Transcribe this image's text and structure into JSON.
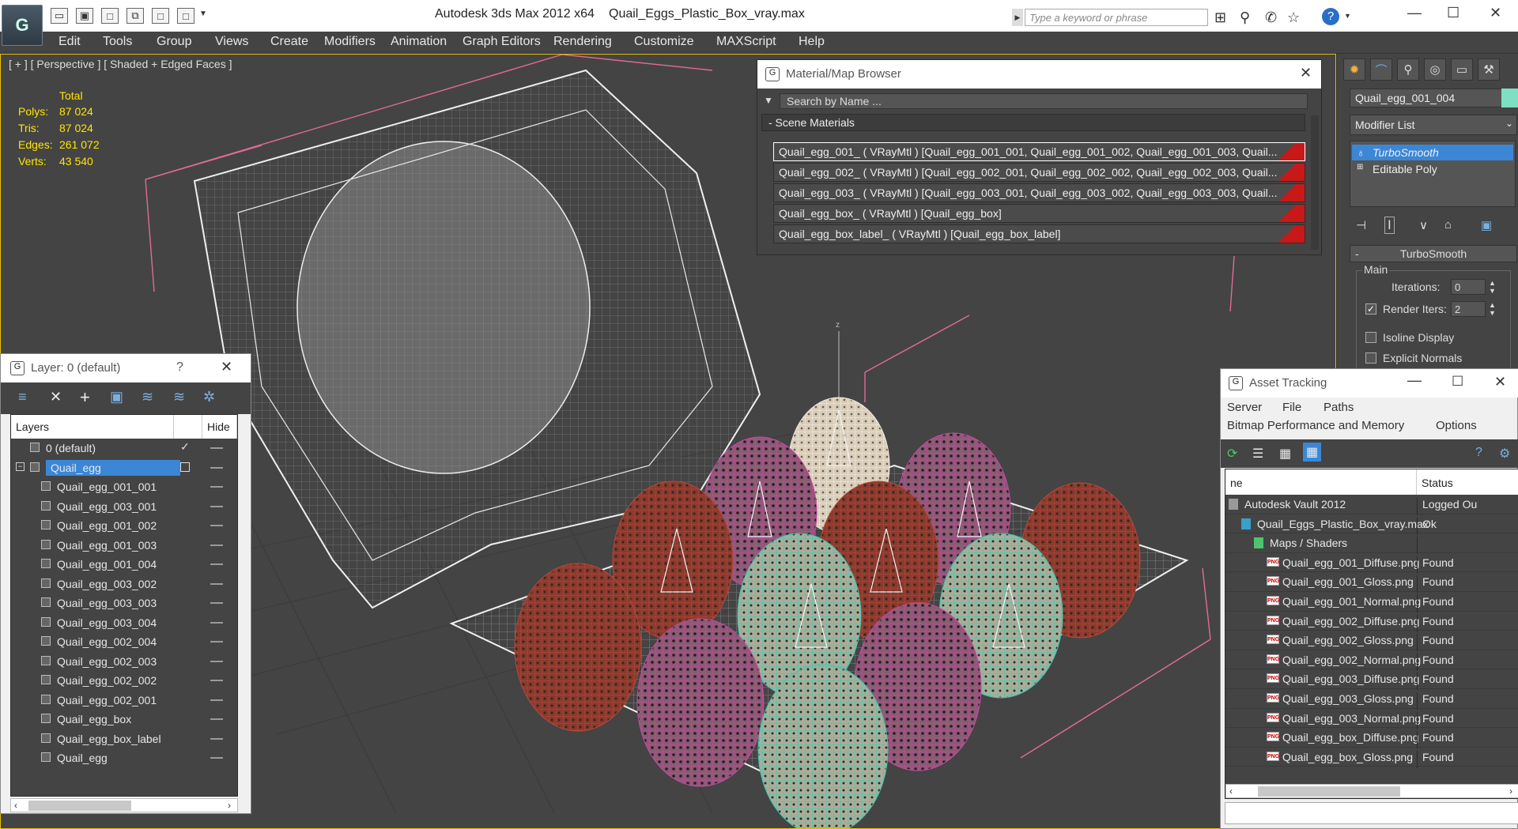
{
  "title_bar": {
    "app_title": "Autodesk 3ds Max  2012 x64",
    "file_title": "Quail_Eggs_Plastic_Box_vray.max",
    "search_placeholder": "Type a keyword or phrase"
  },
  "menu": [
    "Edit",
    "Tools",
    "Group",
    "Views",
    "Create",
    "Modifiers",
    "Animation",
    "Graph Editors",
    "Rendering",
    "Customize",
    "MAXScript",
    "Help"
  ],
  "viewport": {
    "label": "[ + ] [ Perspective ] [ Shaded + Edged Faces ]",
    "stats_header": "Total",
    "stats": [
      {
        "label": "Polys:",
        "value": "87 024"
      },
      {
        "label": "Tris:",
        "value": "87 024"
      },
      {
        "label": "Edges:",
        "value": "261 072"
      },
      {
        "label": "Verts:",
        "value": "43 540"
      }
    ]
  },
  "material_browser": {
    "title": "Material/Map Browser",
    "search_placeholder": "Search by Name ...",
    "section": "- Scene Materials",
    "rows": [
      "Quail_egg_001_  ( VRayMtl )  [Quail_egg_001_001, Quail_egg_001_002, Quail_egg_001_003, Quail...",
      "Quail_egg_002_  ( VRayMtl )  [Quail_egg_002_001, Quail_egg_002_002, Quail_egg_002_003, Quail...",
      "Quail_egg_003_  ( VRayMtl )  [Quail_egg_003_001, Quail_egg_003_002, Quail_egg_003_003, Quail...",
      "Quail_egg_box_  ( VRayMtl )  [Quail_egg_box]",
      "Quail_egg_box_label_  ( VRayMtl )  [Quail_egg_box_label]"
    ]
  },
  "layers": {
    "title": "Layer: 0 (default)",
    "help": "?",
    "col_layers": "Layers",
    "col_hide": "Hide",
    "rows": [
      {
        "name": "0 (default)",
        "type": "layer"
      },
      {
        "name": "Quail_egg",
        "type": "layer-selected"
      },
      {
        "name": "Quail_egg_001_001",
        "type": "object"
      },
      {
        "name": "Quail_egg_003_001",
        "type": "object"
      },
      {
        "name": "Quail_egg_001_002",
        "type": "object"
      },
      {
        "name": "Quail_egg_001_003",
        "type": "object"
      },
      {
        "name": "Quail_egg_001_004",
        "type": "object"
      },
      {
        "name": "Quail_egg_003_002",
        "type": "object"
      },
      {
        "name": "Quail_egg_003_003",
        "type": "object"
      },
      {
        "name": "Quail_egg_003_004",
        "type": "object"
      },
      {
        "name": "Quail_egg_002_004",
        "type": "object"
      },
      {
        "name": "Quail_egg_002_003",
        "type": "object"
      },
      {
        "name": "Quail_egg_002_002",
        "type": "object"
      },
      {
        "name": "Quail_egg_002_001",
        "type": "object"
      },
      {
        "name": "Quail_egg_box",
        "type": "object"
      },
      {
        "name": "Quail_egg_box_label",
        "type": "object"
      },
      {
        "name": "Quail_egg",
        "type": "object"
      }
    ]
  },
  "command_panel": {
    "object_name": "Quail_egg_001_004",
    "object_color": "#7fdfc3",
    "modifier_list": "Modifier List",
    "stack": [
      "TurboSmooth",
      "Editable Poly"
    ],
    "rollout_title": "TurboSmooth",
    "group_main": "Main",
    "iterations_label": "Iterations:",
    "iterations_value": "0",
    "render_iters_label": "Render Iters:",
    "render_iters_value": "2",
    "isoline_label": "Isoline Display",
    "explicit_normals_label": "Explicit Normals"
  },
  "asset_tracking": {
    "title": "Asset Tracking",
    "menu1": [
      "Server",
      "File",
      "Paths"
    ],
    "menu2": [
      "Bitmap Performance and Memory",
      "Options"
    ],
    "col_name": "ne",
    "col_status": "Status",
    "rows": [
      {
        "name": "Autodesk Vault 2012",
        "status": "Logged Ou",
        "indent": 0,
        "icon": "vault"
      },
      {
        "name": "Quail_Eggs_Plastic_Box_vray.max",
        "status": "Ok",
        "indent": 1,
        "icon": "max"
      },
      {
        "name": "Maps / Shaders",
        "status": "",
        "indent": 2,
        "icon": "maps"
      },
      {
        "name": "Quail_egg_001_Diffuse.png",
        "status": "Found",
        "indent": 3,
        "icon": "png"
      },
      {
        "name": "Quail_egg_001_Gloss.png",
        "status": "Found",
        "indent": 3,
        "icon": "png"
      },
      {
        "name": "Quail_egg_001_Normal.png",
        "status": "Found",
        "indent": 3,
        "icon": "png"
      },
      {
        "name": "Quail_egg_002_Diffuse.png",
        "status": "Found",
        "indent": 3,
        "icon": "png"
      },
      {
        "name": "Quail_egg_002_Gloss.png",
        "status": "Found",
        "indent": 3,
        "icon": "png"
      },
      {
        "name": "Quail_egg_002_Normal.png",
        "status": "Found",
        "indent": 3,
        "icon": "png"
      },
      {
        "name": "Quail_egg_003_Diffuse.png",
        "status": "Found",
        "indent": 3,
        "icon": "png"
      },
      {
        "name": "Quail_egg_003_Gloss.png",
        "status": "Found",
        "indent": 3,
        "icon": "png"
      },
      {
        "name": "Quail_egg_003_Normal.png",
        "status": "Found",
        "indent": 3,
        "icon": "png"
      },
      {
        "name": "Quail_egg_box_Diffuse.png",
        "status": "Found",
        "indent": 3,
        "icon": "png"
      },
      {
        "name": "Quail_egg_box_Gloss.png",
        "status": "Found",
        "indent": 3,
        "icon": "png"
      }
    ]
  }
}
